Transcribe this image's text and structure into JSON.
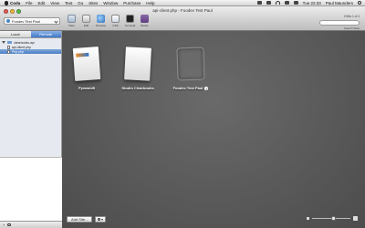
{
  "menubar": {
    "app_name": "Coda",
    "menus": [
      "File",
      "Edit",
      "View",
      "Text",
      "Go",
      "Sites",
      "Window",
      "Purchase",
      "Help"
    ],
    "clock": "Tue 22:33",
    "user": "Paul Maunders"
  },
  "window": {
    "title": "api-client.php - Foodev Test Paul",
    "site_selector": "Foodev Test Paul",
    "tools": [
      {
        "label": "Sites",
        "icon": "sites-icon"
      },
      {
        "label": "Edit",
        "icon": "edit-icon"
      },
      {
        "label": "Preview",
        "icon": "preview-icon"
      },
      {
        "label": "CSS",
        "icon": "css-icon"
      },
      {
        "label": "Terminal",
        "icon": "terminal-icon"
      },
      {
        "label": "Books",
        "icon": "books-icon"
      }
    ],
    "right_meta": "0 files  1 of 4",
    "search_label": "Search Sites"
  },
  "sidebar": {
    "tabs": [
      {
        "label": "Local",
        "active": false
      },
      {
        "label": "Remote",
        "active": true
      }
    ],
    "tree": [
      {
        "label": "clearbooks-api",
        "type": "folder"
      },
      {
        "label": "api-client.php",
        "type": "file"
      },
      {
        "label": "Php.php",
        "type": "file",
        "selected": true
      }
    ]
  },
  "sites": [
    {
      "name": "Pyramid5",
      "thumb": "t1"
    },
    {
      "name": "Studio Clearbooks",
      "thumb": "t2"
    },
    {
      "name": "Foodev Test Paul",
      "thumb": "t3",
      "info": true
    }
  ],
  "bottom": {
    "add_site_label": "Add Site...",
    "zoom_level": 0.55
  }
}
